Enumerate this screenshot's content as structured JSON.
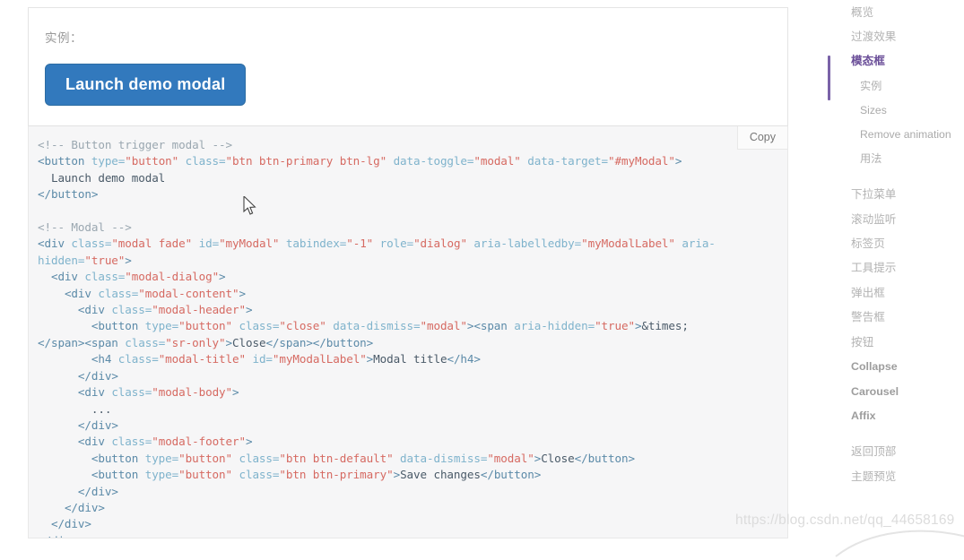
{
  "demo": {
    "label": "实例：",
    "button_label": "Launch demo modal"
  },
  "code_block": {
    "copy_label": "Copy",
    "lines": [
      [
        {
          "t": "<!-- Button trigger modal -->",
          "c": "c-comment"
        }
      ],
      [
        {
          "t": "<button ",
          "c": "c-tag"
        },
        {
          "t": "type=",
          "c": "c-attr"
        },
        {
          "t": "\"button\"",
          "c": "c-str"
        },
        {
          "t": " class=",
          "c": "c-attr"
        },
        {
          "t": "\"btn btn-primary btn-lg\"",
          "c": "c-str"
        },
        {
          "t": " data-toggle=",
          "c": "c-attr"
        },
        {
          "t": "\"modal\"",
          "c": "c-str"
        },
        {
          "t": " data-target=",
          "c": "c-attr"
        },
        {
          "t": "\"#myModal\"",
          "c": "c-str"
        },
        {
          "t": ">",
          "c": "c-tag"
        }
      ],
      [
        {
          "t": "  Launch demo modal",
          "c": "c-txt"
        }
      ],
      [
        {
          "t": "</button>",
          "c": "c-tag"
        }
      ],
      [
        {
          "t": "",
          "c": "c-txt"
        }
      ],
      [
        {
          "t": "<!-- Modal -->",
          "c": "c-comment"
        }
      ],
      [
        {
          "t": "<div ",
          "c": "c-tag"
        },
        {
          "t": "class=",
          "c": "c-attr"
        },
        {
          "t": "\"modal fade\"",
          "c": "c-str"
        },
        {
          "t": " id=",
          "c": "c-attr"
        },
        {
          "t": "\"myModal\"",
          "c": "c-str"
        },
        {
          "t": " tabindex=",
          "c": "c-attr"
        },
        {
          "t": "\"-1\"",
          "c": "c-str"
        },
        {
          "t": " role=",
          "c": "c-attr"
        },
        {
          "t": "\"dialog\"",
          "c": "c-str"
        },
        {
          "t": " aria-labelledby=",
          "c": "c-attr"
        },
        {
          "t": "\"myModalLabel\"",
          "c": "c-str"
        },
        {
          "t": " aria-hidden=",
          "c": "c-attr"
        },
        {
          "t": "\"true\"",
          "c": "c-str"
        },
        {
          "t": ">",
          "c": "c-tag"
        }
      ],
      [
        {
          "t": "  <div ",
          "c": "c-tag"
        },
        {
          "t": "class=",
          "c": "c-attr"
        },
        {
          "t": "\"modal-dialog\"",
          "c": "c-str"
        },
        {
          "t": ">",
          "c": "c-tag"
        }
      ],
      [
        {
          "t": "    <div ",
          "c": "c-tag"
        },
        {
          "t": "class=",
          "c": "c-attr"
        },
        {
          "t": "\"modal-content\"",
          "c": "c-str"
        },
        {
          "t": ">",
          "c": "c-tag"
        }
      ],
      [
        {
          "t": "      <div ",
          "c": "c-tag"
        },
        {
          "t": "class=",
          "c": "c-attr"
        },
        {
          "t": "\"modal-header\"",
          "c": "c-str"
        },
        {
          "t": ">",
          "c": "c-tag"
        }
      ],
      [
        {
          "t": "        <button ",
          "c": "c-tag"
        },
        {
          "t": "type=",
          "c": "c-attr"
        },
        {
          "t": "\"button\"",
          "c": "c-str"
        },
        {
          "t": " class=",
          "c": "c-attr"
        },
        {
          "t": "\"close\"",
          "c": "c-str"
        },
        {
          "t": " data-dismiss=",
          "c": "c-attr"
        },
        {
          "t": "\"modal\"",
          "c": "c-str"
        },
        {
          "t": ">",
          "c": "c-tag"
        },
        {
          "t": "<span ",
          "c": "c-tag"
        },
        {
          "t": "aria-hidden=",
          "c": "c-attr"
        },
        {
          "t": "\"true\"",
          "c": "c-str"
        },
        {
          "t": ">",
          "c": "c-tag"
        },
        {
          "t": "&times;",
          "c": "c-txt"
        }
      ],
      [
        {
          "t": "</span>",
          "c": "c-tag"
        },
        {
          "t": "<span ",
          "c": "c-tag"
        },
        {
          "t": "class=",
          "c": "c-attr"
        },
        {
          "t": "\"sr-only\"",
          "c": "c-str"
        },
        {
          "t": ">",
          "c": "c-tag"
        },
        {
          "t": "Close",
          "c": "c-txt"
        },
        {
          "t": "</span></button>",
          "c": "c-tag"
        }
      ],
      [
        {
          "t": "        <h4 ",
          "c": "c-tag"
        },
        {
          "t": "class=",
          "c": "c-attr"
        },
        {
          "t": "\"modal-title\"",
          "c": "c-str"
        },
        {
          "t": " id=",
          "c": "c-attr"
        },
        {
          "t": "\"myModalLabel\"",
          "c": "c-str"
        },
        {
          "t": ">",
          "c": "c-tag"
        },
        {
          "t": "Modal title",
          "c": "c-txt"
        },
        {
          "t": "</h4>",
          "c": "c-tag"
        }
      ],
      [
        {
          "t": "      </div>",
          "c": "c-tag"
        }
      ],
      [
        {
          "t": "      <div ",
          "c": "c-tag"
        },
        {
          "t": "class=",
          "c": "c-attr"
        },
        {
          "t": "\"modal-body\"",
          "c": "c-str"
        },
        {
          "t": ">",
          "c": "c-tag"
        }
      ],
      [
        {
          "t": "        ...",
          "c": "c-txt"
        }
      ],
      [
        {
          "t": "      </div>",
          "c": "c-tag"
        }
      ],
      [
        {
          "t": "      <div ",
          "c": "c-tag"
        },
        {
          "t": "class=",
          "c": "c-attr"
        },
        {
          "t": "\"modal-footer\"",
          "c": "c-str"
        },
        {
          "t": ">",
          "c": "c-tag"
        }
      ],
      [
        {
          "t": "        <button ",
          "c": "c-tag"
        },
        {
          "t": "type=",
          "c": "c-attr"
        },
        {
          "t": "\"button\"",
          "c": "c-str"
        },
        {
          "t": " class=",
          "c": "c-attr"
        },
        {
          "t": "\"btn btn-default\"",
          "c": "c-str"
        },
        {
          "t": " data-dismiss=",
          "c": "c-attr"
        },
        {
          "t": "\"modal\"",
          "c": "c-str"
        },
        {
          "t": ">",
          "c": "c-tag"
        },
        {
          "t": "Close",
          "c": "c-txt"
        },
        {
          "t": "</button>",
          "c": "c-tag"
        }
      ],
      [
        {
          "t": "        <button ",
          "c": "c-tag"
        },
        {
          "t": "type=",
          "c": "c-attr"
        },
        {
          "t": "\"button\"",
          "c": "c-str"
        },
        {
          "t": " class=",
          "c": "c-attr"
        },
        {
          "t": "\"btn btn-primary\"",
          "c": "c-str"
        },
        {
          "t": ">",
          "c": "c-tag"
        },
        {
          "t": "Save changes",
          "c": "c-txt"
        },
        {
          "t": "</button>",
          "c": "c-tag"
        }
      ],
      [
        {
          "t": "      </div>",
          "c": "c-tag"
        }
      ],
      [
        {
          "t": "    </div>",
          "c": "c-tag"
        }
      ],
      [
        {
          "t": "  </div>",
          "c": "c-tag"
        }
      ],
      [
        {
          "t": "</div>",
          "c": "c-tag"
        }
      ]
    ]
  },
  "sidebar": {
    "items": [
      {
        "label": "概览",
        "active": false,
        "sub": false,
        "latin": false
      },
      {
        "label": "过渡效果",
        "active": false,
        "sub": false,
        "latin": false
      },
      {
        "label": "模态框",
        "active": true,
        "sub": false,
        "latin": false
      },
      {
        "label": "实例",
        "active": false,
        "sub": true,
        "latin": false
      },
      {
        "label": "Sizes",
        "active": false,
        "sub": true,
        "latin": true
      },
      {
        "label": "Remove animation",
        "active": false,
        "sub": true,
        "latin": true
      },
      {
        "label": "用法",
        "active": false,
        "sub": true,
        "latin": false
      },
      {
        "label": "",
        "gap": true
      },
      {
        "label": "下拉菜单",
        "active": false,
        "sub": false,
        "latin": false
      },
      {
        "label": "滚动监听",
        "active": false,
        "sub": false,
        "latin": false
      },
      {
        "label": "标签页",
        "active": false,
        "sub": false,
        "latin": false
      },
      {
        "label": "工具提示",
        "active": false,
        "sub": false,
        "latin": false
      },
      {
        "label": "弹出框",
        "active": false,
        "sub": false,
        "latin": false
      },
      {
        "label": "警告框",
        "active": false,
        "sub": false,
        "latin": false
      },
      {
        "label": "按钮",
        "active": false,
        "sub": false,
        "latin": false
      },
      {
        "label": "Collapse",
        "active": false,
        "sub": false,
        "latin": true
      },
      {
        "label": "Carousel",
        "active": false,
        "sub": false,
        "latin": true
      },
      {
        "label": "Affix",
        "active": false,
        "sub": false,
        "latin": true
      },
      {
        "label": "",
        "gap": true
      },
      {
        "label": "返回顶部",
        "active": false,
        "sub": false,
        "latin": false
      },
      {
        "label": "主题预览",
        "active": false,
        "sub": false,
        "latin": false
      }
    ]
  },
  "watermark": {
    "text": "https://blog.csdn.net/qq_44658169"
  },
  "colors": {
    "primary_button": "#3279bd",
    "active_nav": "#6b4f99",
    "active_bar": "#7a62a8",
    "code_bg": "#f6f6f7",
    "code_string": "#d66a62",
    "code_tag": "#5b8aa8",
    "code_comment": "#9aa7b0"
  }
}
